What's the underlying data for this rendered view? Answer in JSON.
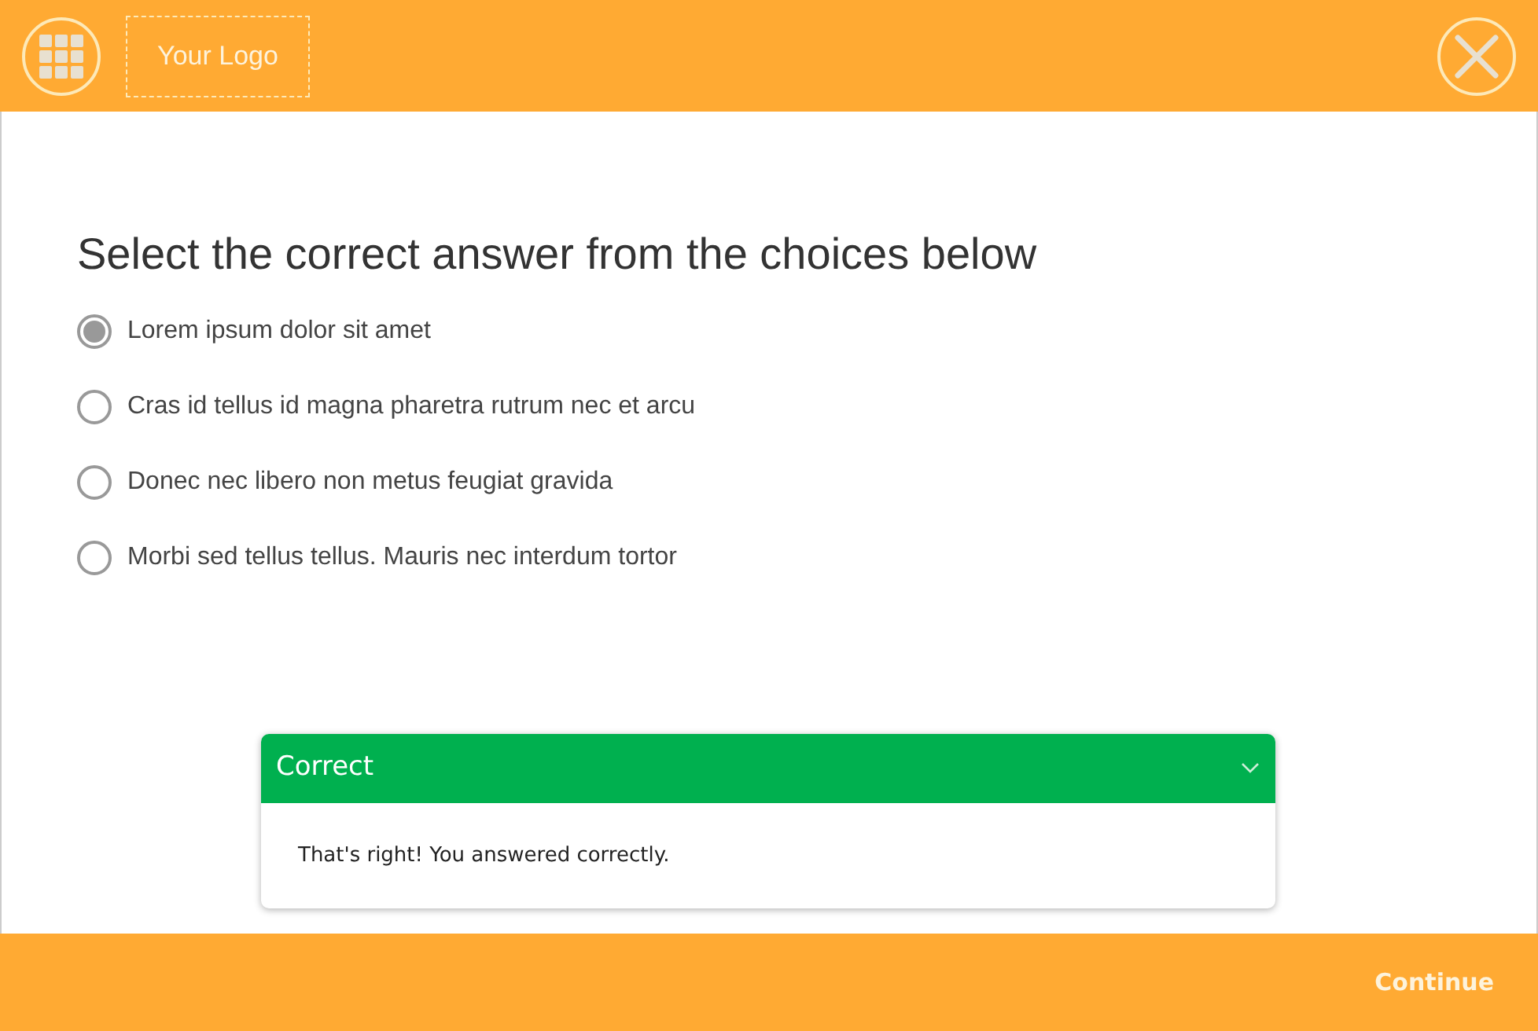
{
  "header": {
    "logo": "Your Logo"
  },
  "question": {
    "prompt": "Select the correct answer from the choices below",
    "choices": [
      {
        "label": "Lorem ipsum dolor sit amet",
        "selected": true
      },
      {
        "label": "Cras id tellus id magna pharetra rutrum nec et arcu",
        "selected": false
      },
      {
        "label": "Donec nec libero non metus feugiat gravida",
        "selected": false
      },
      {
        "label": "Morbi sed tellus tellus. Mauris nec interdum tortor",
        "selected": false
      }
    ]
  },
  "feedback": {
    "kind": "correct",
    "title": "Correct",
    "message": "That's right! You answered correctly."
  },
  "footer": {
    "button": "Continue"
  }
}
